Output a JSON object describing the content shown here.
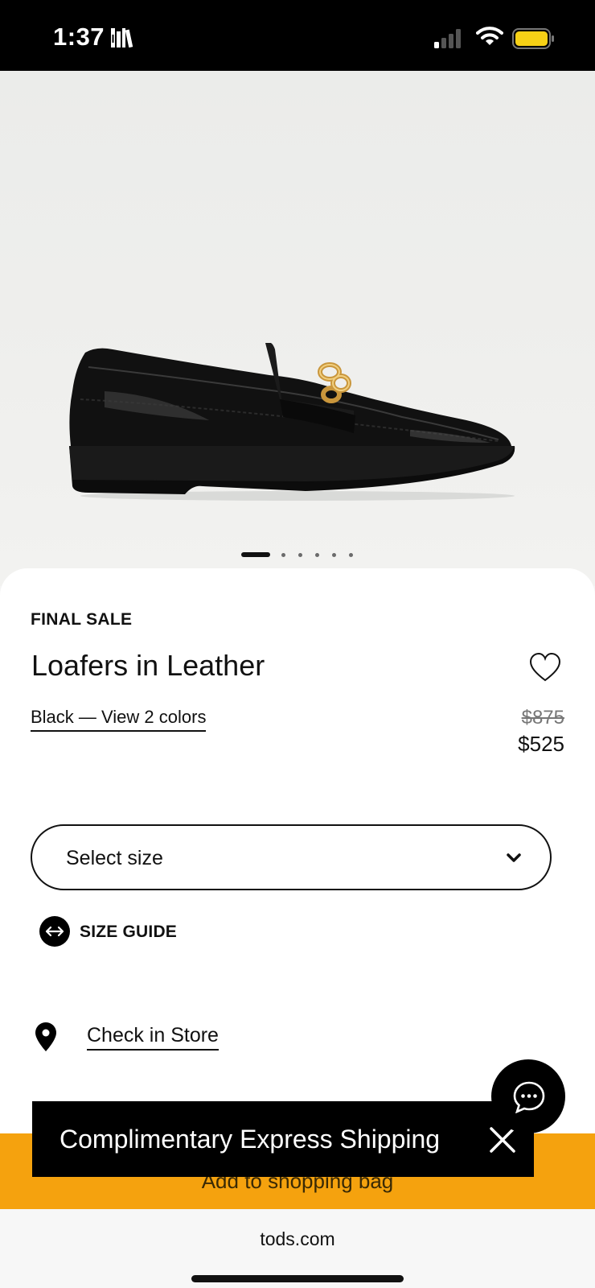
{
  "status_bar": {
    "time": "1:37",
    "icons": [
      "library-icon",
      "cellular-signal-icon",
      "wifi-icon",
      "battery-icon"
    ]
  },
  "product": {
    "badge": "FINAL SALE",
    "title": "Loafers in Leather",
    "color_link": "Black — View 2 colors",
    "price_original": "$875",
    "price_sale": "$525",
    "image_icon": "black-leather-loafer-image",
    "carousel": {
      "total": 6,
      "active": 1
    }
  },
  "size": {
    "select_label": "Select size",
    "guide_label": "SIZE GUIDE"
  },
  "store": {
    "check_label": "Check in Store"
  },
  "cta": {
    "add_to_bag": "Add to shopping bag",
    "color": "#f5a20e"
  },
  "toast": {
    "text": "Complimentary Express Shipping"
  },
  "browser": {
    "url": "tods.com"
  }
}
